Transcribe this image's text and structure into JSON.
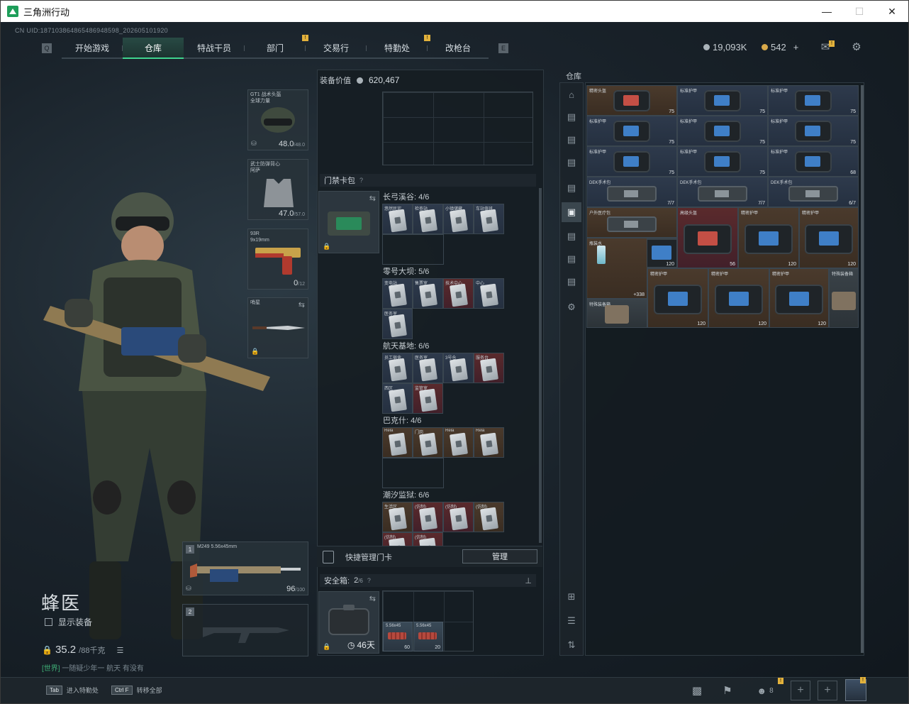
{
  "window": {
    "title": "三角洲行动"
  },
  "uid": "CN UID:187103864865486948598_202605101920",
  "nav": {
    "tabs": [
      {
        "label": "开始游戏",
        "active": false,
        "badge": false
      },
      {
        "label": "仓库",
        "active": true,
        "badge": false
      },
      {
        "label": "特战干员",
        "active": false,
        "badge": false
      },
      {
        "label": "部门",
        "active": false,
        "badge": true
      },
      {
        "label": "交易行",
        "active": false,
        "badge": false
      },
      {
        "label": "特勤处",
        "active": false,
        "badge": true
      },
      {
        "label": "改枪台",
        "active": false,
        "badge": false
      }
    ],
    "left_key": "Q",
    "right_key": "E"
  },
  "currency": {
    "silver": "19,093K",
    "coupons": "542",
    "plus": "+"
  },
  "badge_mark": "!",
  "operator": {
    "name": "蜂医",
    "show_equipment_label": "显示装备",
    "weight_value": "35.2",
    "weight_max": "/88千克",
    "chat_channel": "[世界]",
    "chat_message": "一随疑少年一 航天 有没有"
  },
  "gear": {
    "helmet": {
      "label": "GT1 战术头盔\n全球力量",
      "durability": "48.0",
      "max": "/48.0"
    },
    "armor": {
      "label": "武士防弹背心\n阿萨",
      "durability": "47.0",
      "max": "/57.0"
    },
    "pistol": {
      "label": "93R\n9x19mm",
      "ammo": "0",
      "max": "/12"
    },
    "melee": {
      "label": "哨星"
    },
    "primary": {
      "slot": "1",
      "label": "M249\n5.56x45mm",
      "ammo": "96",
      "max": "/100"
    },
    "secondary": {
      "slot": "2"
    }
  },
  "equipment_value": {
    "label": "装备价值",
    "value": "620,467"
  },
  "keycard_case": {
    "title": "门禁卡包",
    "maps": [
      {
        "name": "长弓溪谷: 4/6",
        "cards": [
          {
            "n": "悠然民宅",
            "c": "blue"
          },
          {
            "n": "检查站",
            "c": "blue"
          },
          {
            "n": "小镇储藏",
            "c": "blue"
          },
          {
            "n": "车站值班",
            "c": "blue"
          }
        ]
      },
      {
        "name": "零号大坝: 5/6",
        "cards": [
          {
            "n": "变电站",
            "c": "blue"
          },
          {
            "n": "售票室",
            "c": "blue"
          },
          {
            "n": "技术中心",
            "c": "red"
          },
          {
            "n": "中心",
            "c": "blue"
          },
          {
            "n": "医务室",
            "c": "blue"
          }
        ]
      },
      {
        "name": "航天基地: 6/6",
        "cards": [
          {
            "n": "员工宿舍",
            "c": "blue"
          },
          {
            "n": "医务室",
            "c": "blue"
          },
          {
            "n": "3号仓",
            "c": "blue"
          },
          {
            "n": "服务台",
            "c": "red"
          },
          {
            "n": "西区",
            "c": "blue"
          },
          {
            "n": "监管室",
            "c": "red"
          }
        ]
      },
      {
        "name": "巴克什: 4/6",
        "cards": [
          {
            "n": "Rela",
            "c": "brown"
          },
          {
            "n": "门岗",
            "c": "brown"
          },
          {
            "n": "Rela",
            "c": "brown"
          },
          {
            "n": "Rela",
            "c": "brown"
          }
        ]
      },
      {
        "name": "潮汐监狱: 6/6",
        "cards": [
          {
            "n": "生活区",
            "c": "brown"
          },
          {
            "n": "(仿制)",
            "c": "red"
          },
          {
            "n": "(仿制)",
            "c": "red"
          },
          {
            "n": "(仿制)",
            "c": "brown"
          },
          {
            "n": "(仿制)",
            "c": "red"
          },
          {
            "n": "(仿制)",
            "c": "red"
          }
        ]
      }
    ]
  },
  "quick_manage": {
    "label": "快捷管理门卡",
    "button": "管理"
  },
  "safe_box": {
    "title": "安全箱:",
    "count": "2",
    "max": "/6",
    "days": "46天",
    "ammo": [
      {
        "name": "5.56x45",
        "count": "60"
      },
      {
        "name": "5.56x45",
        "count": "20"
      }
    ]
  },
  "warehouse": {
    "title": "仓库",
    "items": [
      {
        "name": "精密头盔",
        "count": "75",
        "bg": "brown",
        "kind": "armor red"
      },
      {
        "name": "标准护甲",
        "count": "75",
        "bg": "blue",
        "kind": "armor"
      },
      {
        "name": "标准护甲",
        "count": "75",
        "bg": "blue",
        "kind": "armor"
      },
      {
        "name": "标准护甲",
        "count": "75",
        "bg": "blue",
        "kind": "armor"
      },
      {
        "name": "标准护甲",
        "count": "75",
        "bg": "blue",
        "kind": "armor"
      },
      {
        "name": "标准护甲",
        "count": "75",
        "bg": "blue",
        "kind": "armor"
      },
      {
        "name": "标准护甲",
        "count": "75",
        "bg": "blue",
        "kind": "armor"
      },
      {
        "name": "标准护甲",
        "count": "75",
        "bg": "blue",
        "kind": "armor"
      },
      {
        "name": "标准护甲",
        "count": "68",
        "bg": "blue",
        "kind": "armor"
      },
      {
        "name": "DEK手术包",
        "count": "7/7",
        "bg": "blue",
        "kind": "kit"
      },
      {
        "name": "DEK手术包",
        "count": "7/7",
        "bg": "blue",
        "kind": "kit"
      },
      {
        "name": "DEK手术包",
        "count": "6/7",
        "bg": "blue",
        "kind": "kit"
      },
      {
        "name": "户外医疗包",
        "count": "",
        "bg": "brown",
        "kind": "kit"
      },
      {
        "name": "高级头盔",
        "count": "56",
        "bg": "red",
        "kind": "armor red big"
      },
      {
        "name": "精密护甲",
        "count": "120",
        "bg": "brown",
        "kind": "armor big"
      },
      {
        "name": "精密护甲",
        "count": "120",
        "bg": "brown",
        "kind": "armor big"
      },
      {
        "name": "精密护甲",
        "count": "120",
        "bg": "brown",
        "kind": "armor big"
      },
      {
        "name": "瓶装水",
        "count": "+338",
        "bg": "brown",
        "kind": "none"
      },
      {
        "name": "精密护甲",
        "count": "120",
        "bg": "brown",
        "kind": "armor big"
      },
      {
        "name": "精密护甲",
        "count": "120",
        "bg": "brown",
        "kind": "armor big"
      },
      {
        "name": "精密护甲",
        "count": "120",
        "bg": "brown",
        "kind": "armor big"
      },
      {
        "name": "特殊装备箱",
        "count": "",
        "bg": "gray",
        "kind": "case"
      },
      {
        "name": "特殊装备箱",
        "count": "",
        "bg": "gray",
        "kind": "case"
      }
    ]
  },
  "bottom": {
    "hotkeys": [
      {
        "key": "Tab",
        "label": "进入特勤处"
      },
      {
        "key": "Ctrl F",
        "label": "转移全部"
      }
    ],
    "friends_count": "8"
  },
  "colors": {
    "accent": "#3fd48e",
    "badge": "#e3b23c",
    "card_blue": "#2e3a4c",
    "card_red": "#5a2a2c",
    "card_brown": "#4a3a2c"
  }
}
